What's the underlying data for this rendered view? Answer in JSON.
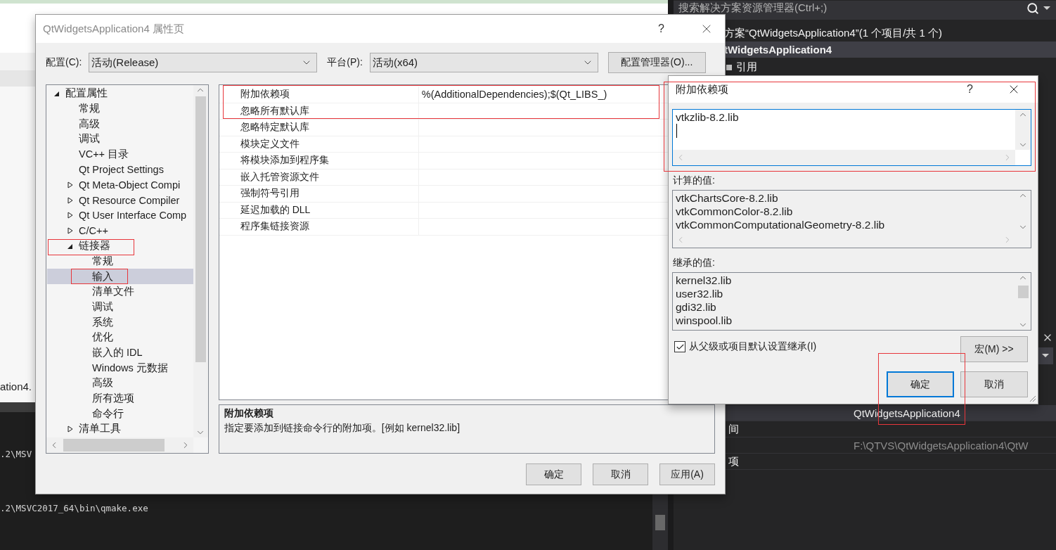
{
  "ide": {
    "editor_fragment": "ation4.",
    "output_lines": [
      ".2\\MSV",
      ".2\\MSVC2017_64\\bin\\qmake.exe"
    ],
    "solution_explorer": {
      "search_placeholder": "搜索解决方案资源管理器(Ctrl+;)",
      "items": [
        {
          "label": "方案“QtWidgetsApplication4”(1 个项目/共 1 个)",
          "selected": false
        },
        {
          "label": "tWidgetsApplication4",
          "selected": true
        },
        {
          "label": "引用",
          "selected": false
        }
      ]
    },
    "properties": {
      "rows": [
        {
          "value": "QtWidgetsApplication4",
          "selected": true
        },
        {
          "name": "间",
          "selected": false
        },
        {
          "value": "F:\\QTVS\\QtWidgetsApplication4\\QtW",
          "selected": false
        },
        {
          "name": "项",
          "selected": false
        }
      ]
    }
  },
  "property_dialog": {
    "title": "QtWidgetsApplication4 属性页",
    "help": "?",
    "config_label": "配置(C):",
    "config_value": "活动(Release)",
    "platform_label": "平台(P):",
    "platform_value": "活动(x64)",
    "manager_button": "配置管理器(O)...",
    "tree": [
      {
        "label": "配置属性",
        "selected": false,
        "expanded": true,
        "children": [
          {
            "label": "常规",
            "selected": false
          },
          {
            "label": "高级",
            "selected": false
          },
          {
            "label": "调试",
            "selected": false
          },
          {
            "label": "VC++ 目录",
            "selected": false
          },
          {
            "label": "Qt Project Settings",
            "selected": false
          },
          {
            "label": "Qt Meta-Object Compi",
            "selected": false,
            "expanded": false
          },
          {
            "label": "Qt Resource Compiler",
            "selected": false,
            "expanded": false
          },
          {
            "label": "Qt User Interface Comp",
            "selected": false,
            "expanded": false
          },
          {
            "label": "C/C++",
            "selected": false,
            "expanded": false
          },
          {
            "label": "链接器",
            "selected": false,
            "expanded": true,
            "children": [
              {
                "label": "常规",
                "selected": false
              },
              {
                "label": "输入",
                "selected": true
              },
              {
                "label": "清单文件",
                "selected": false
              },
              {
                "label": "调试",
                "selected": false
              },
              {
                "label": "系统",
                "selected": false
              },
              {
                "label": "优化",
                "selected": false
              },
              {
                "label": "嵌入的 IDL",
                "selected": false
              },
              {
                "label": "Windows 元数据",
                "selected": false
              },
              {
                "label": "高级",
                "selected": false
              },
              {
                "label": "所有选项",
                "selected": false
              },
              {
                "label": "命令行",
                "selected": false
              }
            ]
          },
          {
            "label": "清单工具",
            "selected": false,
            "expanded": false
          }
        ]
      }
    ],
    "grid": {
      "rows": [
        {
          "name": "附加依赖项",
          "value": "%(AdditionalDependencies);$(Qt_LIBS_)"
        },
        {
          "name": "忽略所有默认库"
        },
        {
          "name": "忽略特定默认库"
        },
        {
          "name": "模块定义文件"
        },
        {
          "name": "将模块添加到程序集"
        },
        {
          "name": "嵌入托管资源文件"
        },
        {
          "name": "强制符号引用"
        },
        {
          "name": "延迟加载的 DLL"
        },
        {
          "name": "程序集链接资源"
        }
      ]
    },
    "description": {
      "title": "附加依赖项",
      "text": "指定要添加到链接命令行的附加项。[例如 kernel32.lib]"
    },
    "buttons": [
      "确定",
      "取消",
      "应用(A)"
    ]
  },
  "edit_dialog": {
    "title": "附加依赖项",
    "help": "?",
    "value": "vtkzlib-8.2.lib",
    "computed_label": "计算的值:",
    "computed": [
      "vtkChartsCore-8.2.lib",
      "vtkCommonColor-8.2.lib",
      "vtkCommonComputationalGeometry-8.2.lib"
    ],
    "inherited_label": "继承的值:",
    "inherited": [
      "kernel32.lib",
      "user32.lib",
      "gdi32.lib",
      "winspool.lib"
    ],
    "inherit_checkbox": {
      "label": "从父级或项目默认设置继承(I)",
      "checked": true
    },
    "macro_button": "宏(M) >>",
    "buttons": [
      {
        "label": "确定",
        "default": true
      },
      {
        "label": "取消",
        "default": false
      }
    ]
  }
}
